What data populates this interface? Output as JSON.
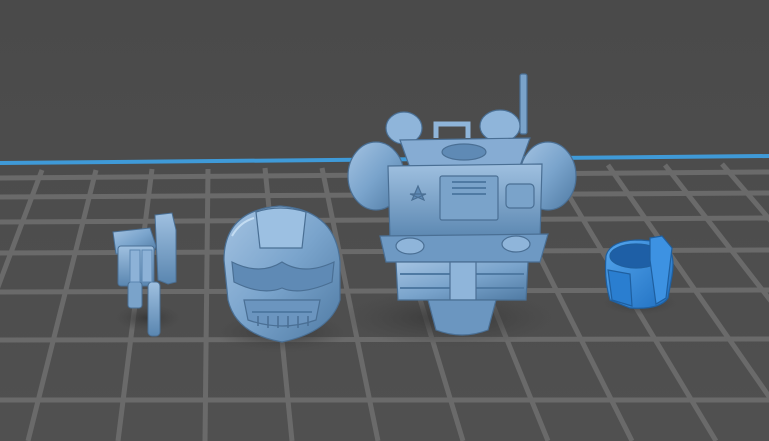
{
  "scene": {
    "description_free": true,
    "colors": {
      "background": "#4d4d4d",
      "grid_line": "#6b6b6b",
      "edge_line": "#3f9ad8",
      "model_main": "#6f9bc4",
      "model_shadow": "#4f7aa3",
      "model_highlight": "#a9c8e6",
      "model_selected": "#2f86d8",
      "ground_shadow": "#3e3e3e"
    },
    "objects": [
      {
        "id": "arm-gun-part",
        "icon": "gun-arm-model",
        "selected": false
      },
      {
        "id": "helmet-part",
        "icon": "helmet-model",
        "selected": false
      },
      {
        "id": "torso-part",
        "icon": "torso-armor-model",
        "selected": false
      },
      {
        "id": "wrist-cuff-part",
        "icon": "cuff-model",
        "selected": true
      }
    ]
  }
}
